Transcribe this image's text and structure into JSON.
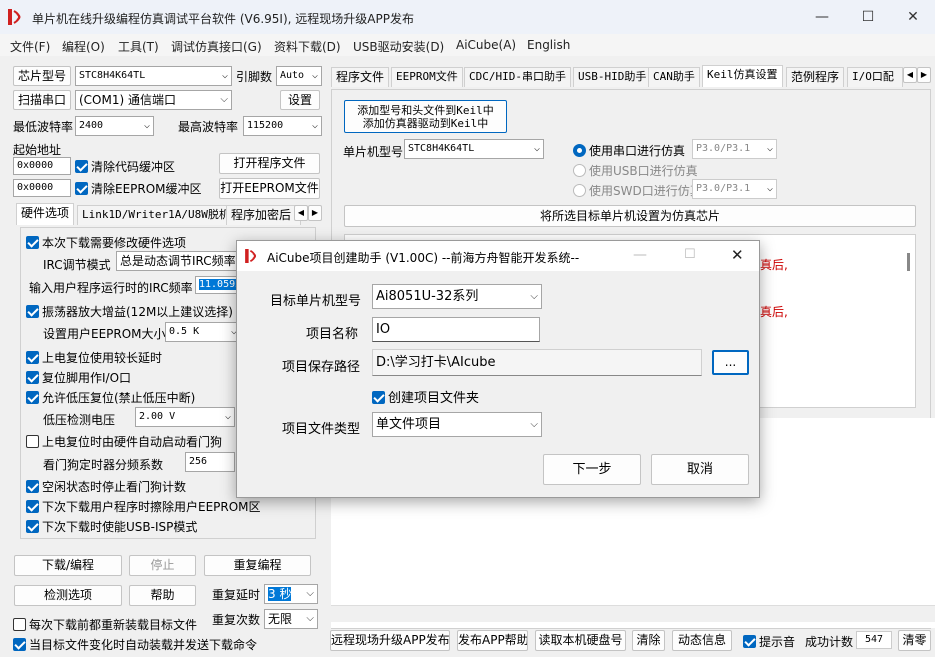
{
  "window": {
    "title": "单片机在线升级编程仿真调试平台软件 (V6.95I), 远程现场升级APP发布",
    "minimize": "—",
    "maximize": "☐",
    "close": "✕"
  },
  "menu": [
    "文件(F)",
    "编程(O)",
    "工具(T)",
    "调试仿真接口(G)",
    "资料下载(D)",
    "USB驱动安装(D)",
    "AiCube(A)",
    "English"
  ],
  "left": {
    "chip_label": "芯片型号",
    "chip_value": "STC8H4K64TL",
    "pin_label": "引脚数",
    "pin_value": "Auto",
    "scan_button": "扫描串口",
    "port_value": "(COM1) 通信端口",
    "settings_button": "设置",
    "min_baud_label": "最低波特率",
    "min_baud_value": "2400",
    "max_baud_label": "最高波特率",
    "max_baud_value": "115200",
    "start_addr_label": "起始地址",
    "addr1": "0x0000",
    "clear_code_label": "清除代码缓冲区",
    "open_prog_button": "打开程序文件",
    "addr2": "0x0000",
    "clear_eeprom_label": "清除EEPROM缓冲区",
    "open_eeprom_button": "打开EEPROM文件",
    "tabs": [
      "硬件选项",
      "Link1D/Writer1A/U8W脱机",
      "程序加密后"
    ],
    "options": {
      "modify_hw": "本次下载需要修改硬件选项",
      "irc_mode_label": "IRC调节模式",
      "irc_mode_value": "总是动态调节IRC频率",
      "irc_freq_label": "输入用户程序运行时的IRC频率",
      "irc_freq_value": "11.0592",
      "osc_gain": "振荡器放大增益(12M以上建议选择)",
      "eeprom_size_label": "设置用户EEPROM大小",
      "eeprom_size_value": "0.5 K",
      "long_delay": "上电复位使用较长延时",
      "reset_io": "复位脚用作I/O口",
      "lvd_reset": "允许低压复位(禁止低压中断)",
      "lvd_label": "低压检测电压",
      "lvd_value": "2.00 V",
      "wdt_auto": "上电复位时由硬件自动启动看门狗",
      "wdt_div_label": "看门狗定时器分频系数",
      "wdt_div_value": "256",
      "idle_wdt": "空闲状态时停止看门狗计数",
      "erase_eeprom": "下次下载用户程序时擦除用户EEPROM区",
      "usb_isp": "下次下载时使能USB-ISP模式"
    },
    "download_button": "下载/编程",
    "stop_button": "停止",
    "reprog_button": "重复编程",
    "detect_button": "检测选项",
    "help_button": "帮助",
    "repeat_delay_label": "重复延时",
    "repeat_delay_value": "3 秒",
    "repeat_count_label": "重复次数",
    "repeat_count_value": "无限",
    "reload_label": "每次下载前都重新装载目标文件",
    "auto_load_label": "当目标文件变化时自动装载并发送下载命令"
  },
  "right": {
    "tabs": [
      "程序文件",
      "EEPROM文件",
      "CDC/HID-串口助手",
      "USB-HID助手",
      "CAN助手",
      "Keil仿真设置",
      "范例程序",
      "I/O口配"
    ],
    "add_keil_line1": "添加型号和头文件到Keil中",
    "add_keil_line2": "添加仿真器驱动到Keil中",
    "mcu_label": "单片机型号",
    "mcu_value": "STC8H4K64TL",
    "uart_sim": "使用串口进行仿真",
    "uart_pins": "P3.0/P3.1",
    "usb_sim": "使用USB口进行仿真",
    "swd_sim": "使用SWD口进行仿真",
    "swd_pins": "P3.0/P3.1",
    "set_sim_chip_button": "将所选目标单片机设置为仿真芯片",
    "red_text_1": "真后,",
    "red_text_2": "真后,",
    "bottom": {
      "remote_app_button": "远程现场升级APP发布",
      "publish_help_button": "发布APP帮助",
      "read_disk_button": "读取本机硬盘号",
      "clear_button": "清除",
      "anim_button": "动态信息",
      "beep_label": "提示音",
      "success_label": "成功计数",
      "success_value": "547",
      "clear2_button": "清零"
    }
  },
  "dialog": {
    "title": "AiCube项目创建助手 (V1.00C) --前海方舟智能开发系统--",
    "target_label": "目标单片机型号",
    "target_value": "Ai8051U-32系列",
    "name_label": "项目名称",
    "name_value": "IO",
    "path_label": "项目保存路径",
    "path_value": "D:\\学习打卡\\AIcube",
    "browse_button": "...",
    "create_folder_label": "创建项目文件夹",
    "type_label": "项目文件类型",
    "type_value": "单文件项目",
    "next_button": "下一步",
    "cancel_button": "取消"
  },
  "colors": {
    "accent": "#0067c0",
    "red_text": "#cc0000",
    "selected_field": "#0078d7"
  }
}
